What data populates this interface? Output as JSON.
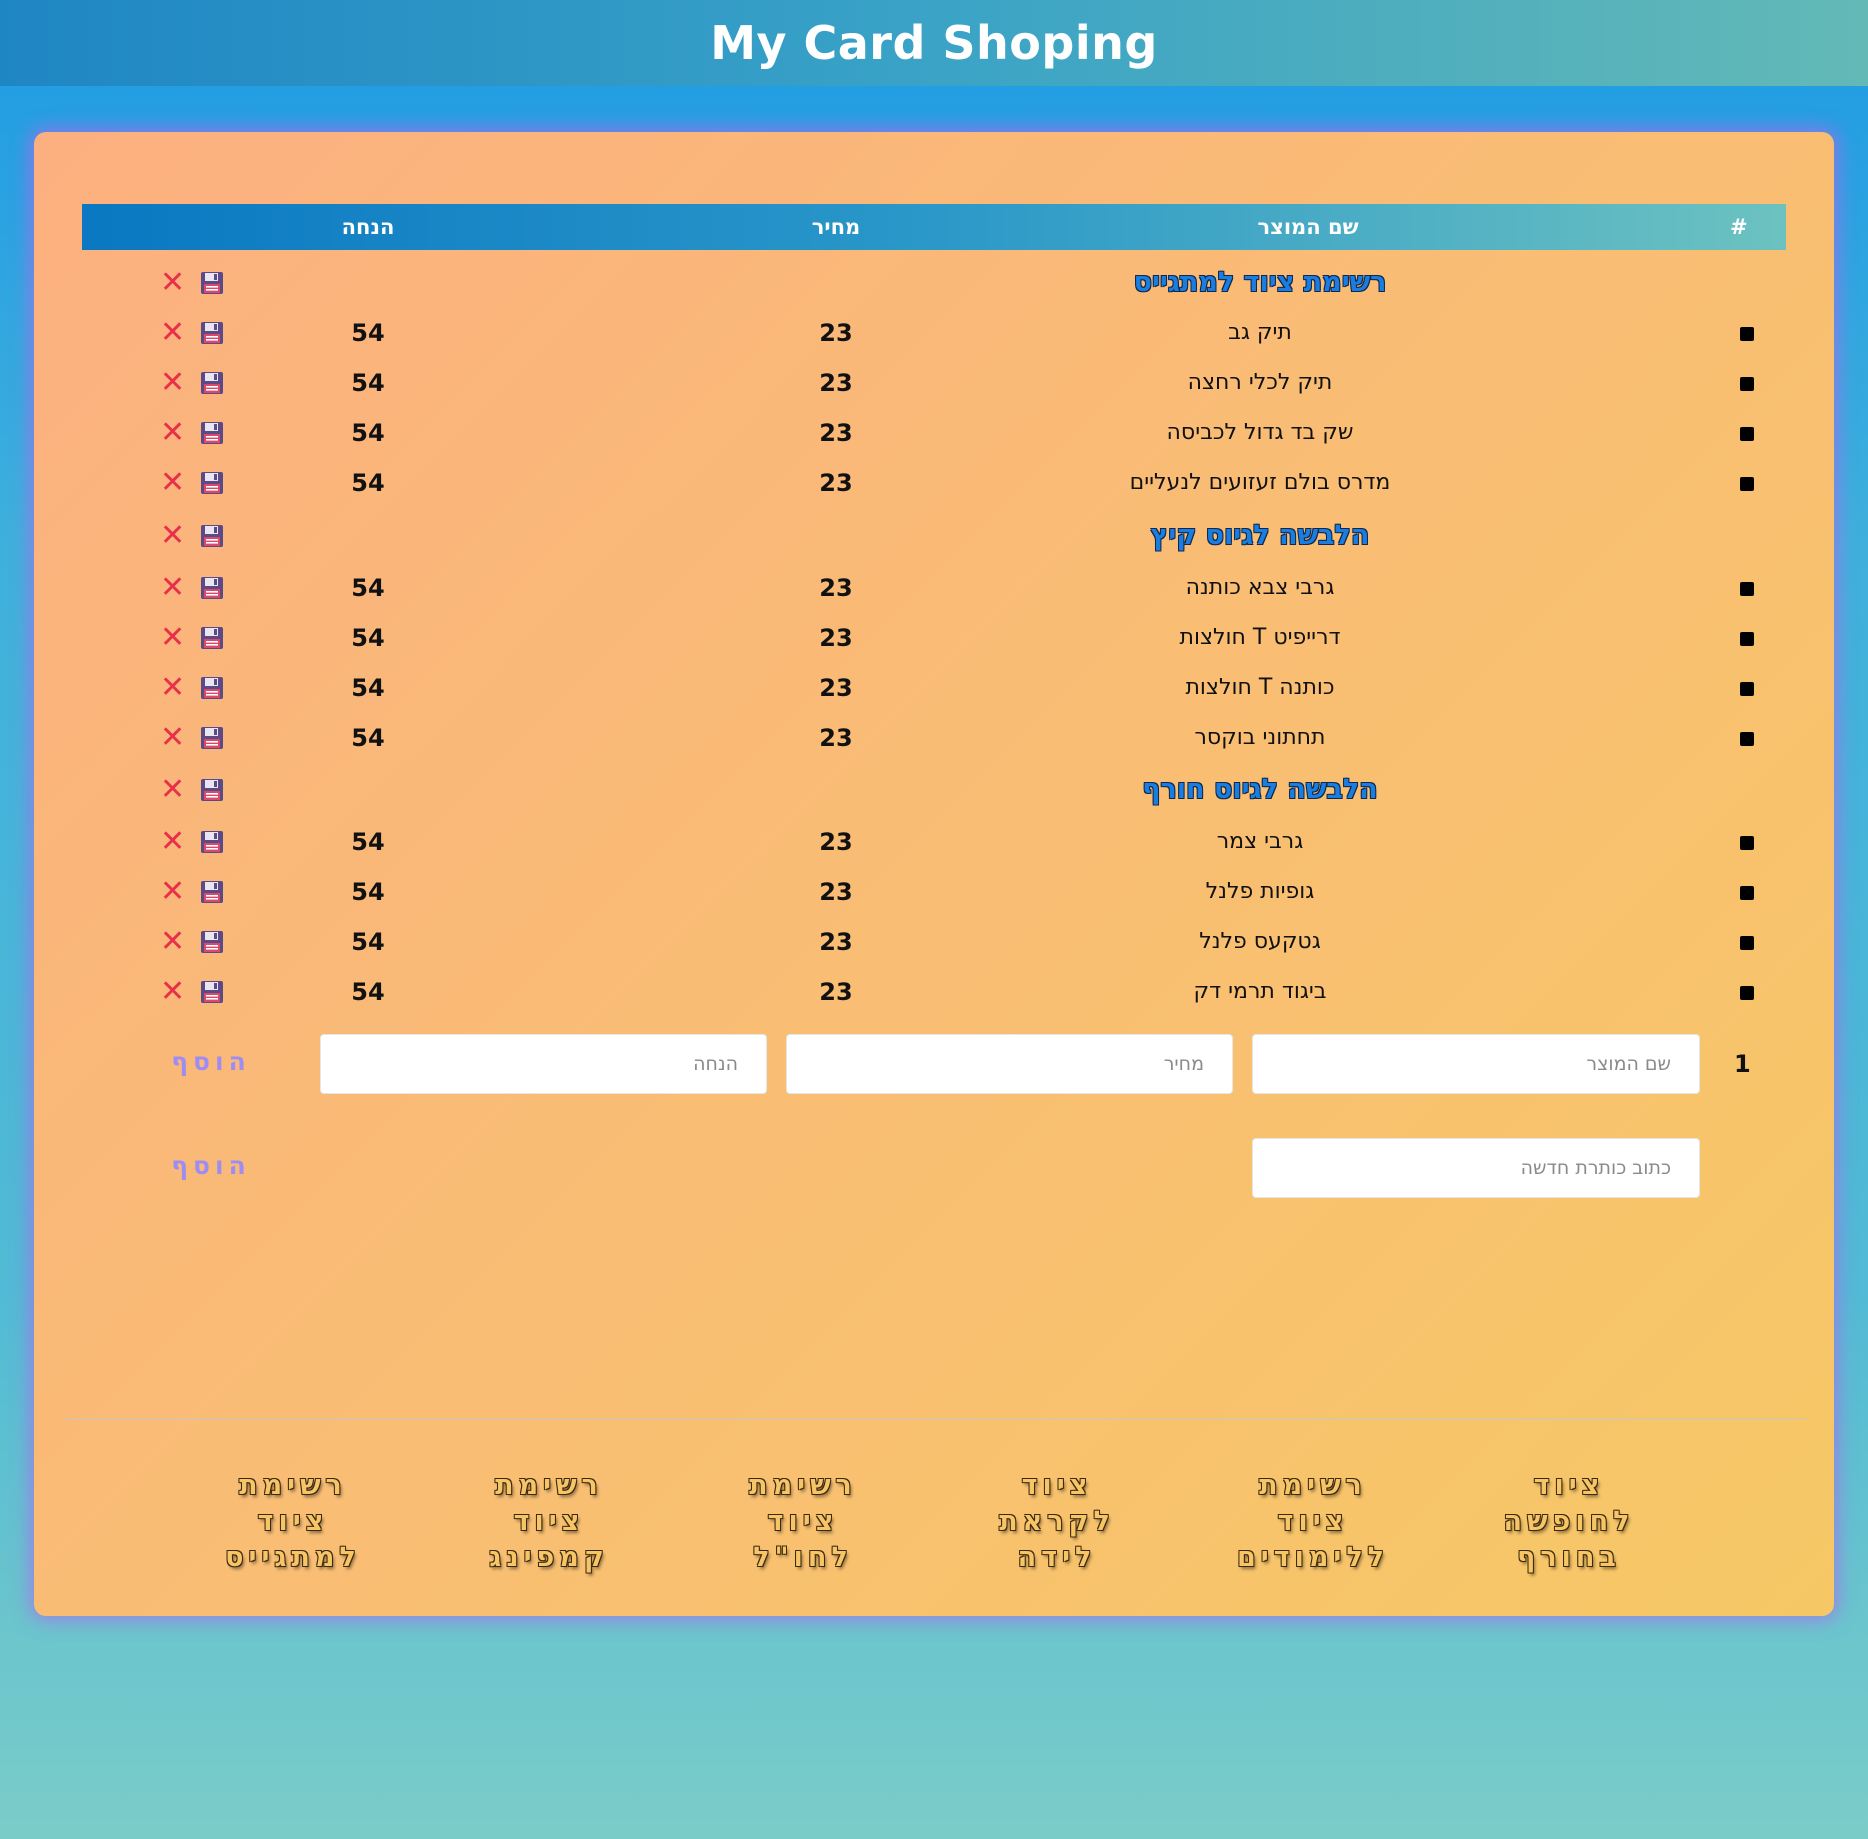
{
  "header": {
    "title": "My Card Shoping"
  },
  "table": {
    "columns": {
      "index": "#",
      "name": "שם המוצר",
      "price": "מחיר",
      "discount": "הנחה"
    },
    "rows": [
      {
        "type": "heading",
        "text": "רשימת ציוד למתגייס"
      },
      {
        "type": "item",
        "name": "תיק גב",
        "price": "23",
        "discount": "54"
      },
      {
        "type": "item",
        "name": "תיק לכלי רחצה",
        "price": "23",
        "discount": "54"
      },
      {
        "type": "item",
        "name": "שק בד גדול לכביסה",
        "price": "23",
        "discount": "54"
      },
      {
        "type": "item",
        "name": "מדרס בולם זעזועים לנעליים",
        "price": "23",
        "discount": "54"
      },
      {
        "type": "heading",
        "text": "הלבשה לגיוס קיץ"
      },
      {
        "type": "item",
        "name": "גרבי צבא כותנה",
        "price": "23",
        "discount": "54"
      },
      {
        "type": "item",
        "name": "חולצות T דרייפיט",
        "price": "23",
        "discount": "54"
      },
      {
        "type": "item",
        "name": "חולצות T כותנה",
        "price": "23",
        "discount": "54"
      },
      {
        "type": "item",
        "name": "תחתוני בוקסר",
        "price": "23",
        "discount": "54"
      },
      {
        "type": "heading",
        "text": "הלבשה לגיוס חורף"
      },
      {
        "type": "item",
        "name": "גרבי צמר",
        "price": "23",
        "discount": "54"
      },
      {
        "type": "item",
        "name": "גופיות פלנל",
        "price": "23",
        "discount": "54"
      },
      {
        "type": "item",
        "name": "גטקעס פלנל",
        "price": "23",
        "discount": "54"
      },
      {
        "type": "item",
        "name": "ביגוד תרמי דק",
        "price": "23",
        "discount": "54"
      }
    ],
    "row_icons": {
      "delete": "close-x-icon",
      "save": "floppy-disk-icon"
    }
  },
  "add_item": {
    "row_number": "1",
    "name_placeholder": "שם המוצר",
    "price_placeholder": "מחיר",
    "discount_placeholder": "הנחה",
    "button_label": "הוסף"
  },
  "add_heading": {
    "placeholder": "כתוב כותרת חדשה",
    "button_label": "הוסף"
  },
  "footer_links": [
    "ציוד\nלחופשה\nבחורף",
    "רשימת\nציוד\nללימודים",
    "ציוד\nלקראת\nלידה",
    "רשימת\nציוד\nלחו\"ל",
    "רשימת\nציוד\nקמפינג",
    "רשימת\nציוד\nלמתגייס"
  ],
  "colors": {
    "delete": "#e8304a",
    "heading_text": "#1a7ee0",
    "add_button": "#9d8cf2",
    "card_glow": "#aa6eeb"
  }
}
